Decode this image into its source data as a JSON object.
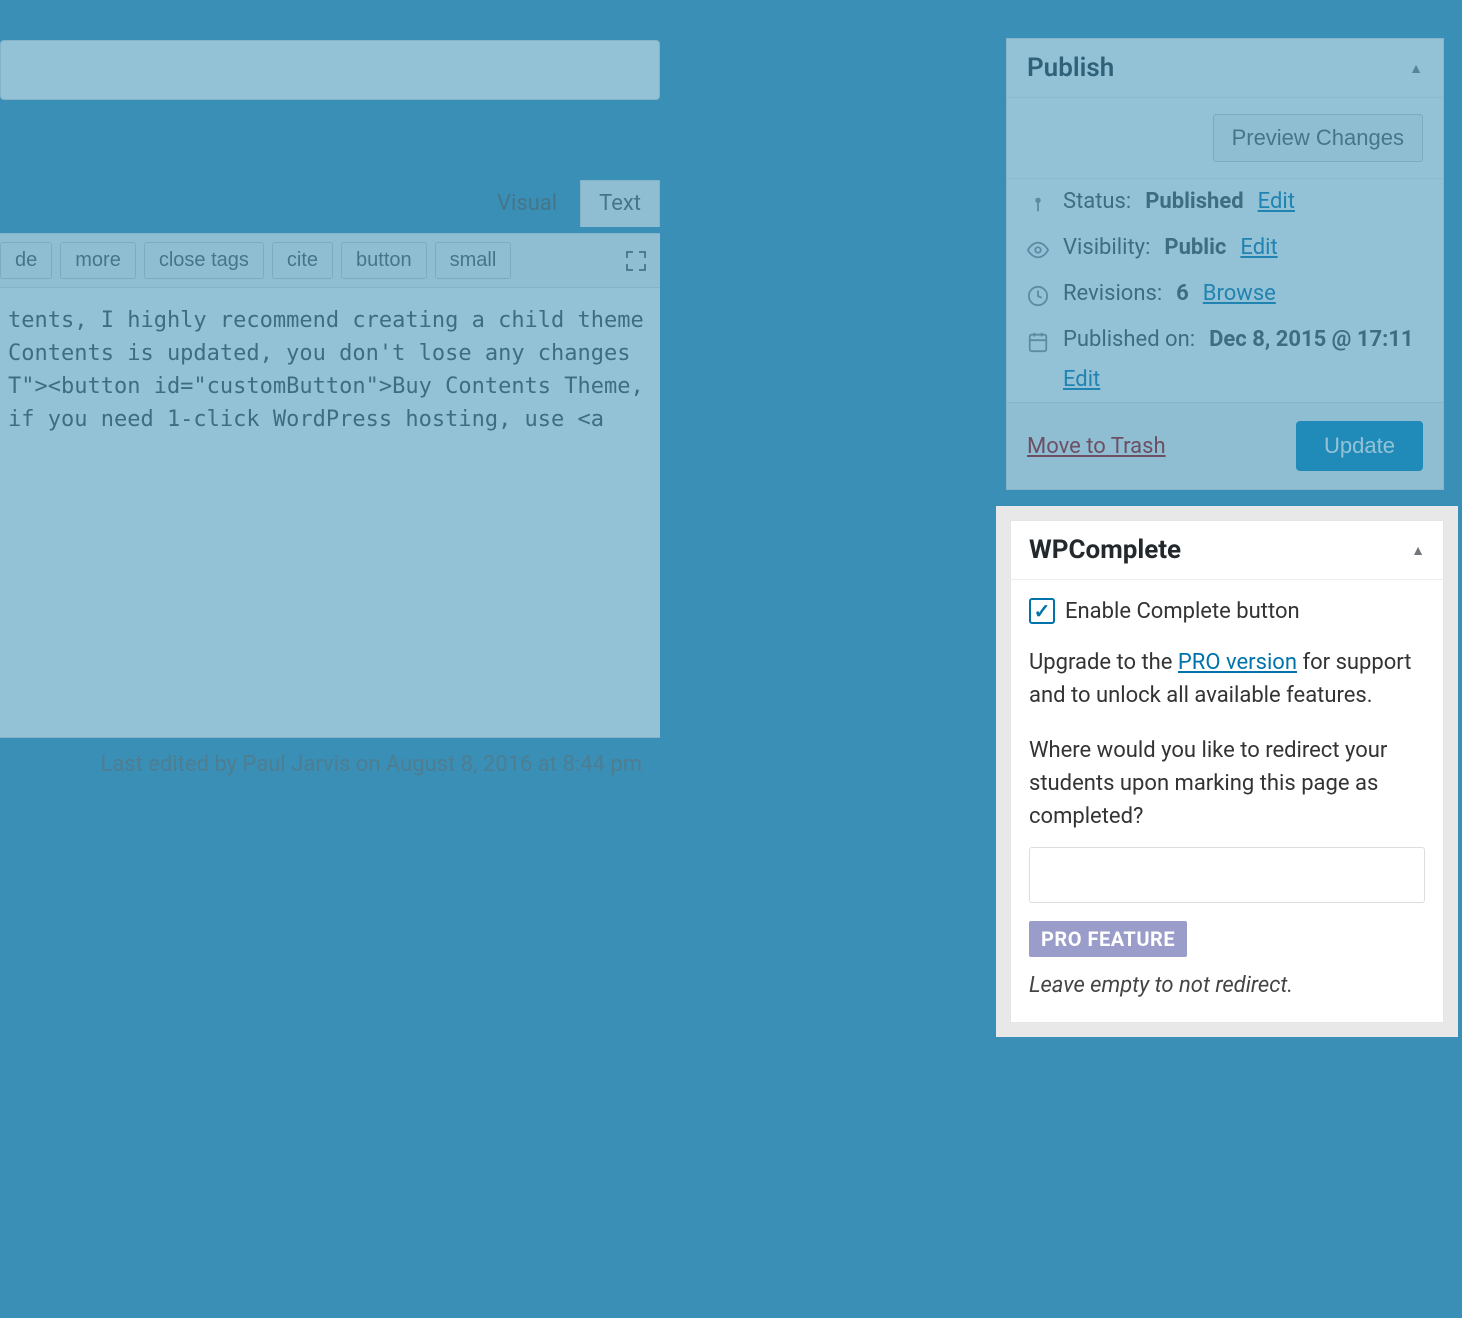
{
  "editor": {
    "tabs": {
      "visual": "Visual",
      "text": "Text"
    },
    "toolbar": {
      "de": "de",
      "more": "more",
      "close_tags": "close tags",
      "cite": "cite",
      "button": "button",
      "small": "small"
    },
    "code_lines": [
      "tents, I highly recommend creating a child theme and",
      "Contents is updated, you don't lose any changes",
      "",
      "",
      "",
      "",
      "T\"><button id=\"customButton\">Buy Contents Theme,",
      "",
      "",
      "if you need 1-click WordPress hosting, use <a"
    ],
    "last_edited": "Last edited by Paul Jarvis on August 8, 2016 at 8:44 pm"
  },
  "publish": {
    "title": "Publish",
    "preview": "Preview Changes",
    "status_label": "Status: ",
    "status_value": "Published",
    "edit": "Edit",
    "visibility_label": "Visibility: ",
    "visibility_value": "Public",
    "revisions_label": "Revisions: ",
    "revisions_value": "6",
    "browse": "Browse",
    "published_label": "Published on: ",
    "published_value": "Dec 8, 2015 @ 17:11",
    "trash": "Move to Trash",
    "update": "Update"
  },
  "wpcomplete": {
    "title": "WPComplete",
    "enable_label": "Enable Complete button",
    "upgrade_prefix": "Upgrade to the ",
    "pro_link": "PRO version",
    "upgrade_suffix": " for support and to unlock all available features.",
    "redirect_question": "Where would you like to redirect your students upon marking this page as completed?",
    "pro_badge": "PRO FEATURE",
    "hint": "Leave empty to not redirect."
  }
}
